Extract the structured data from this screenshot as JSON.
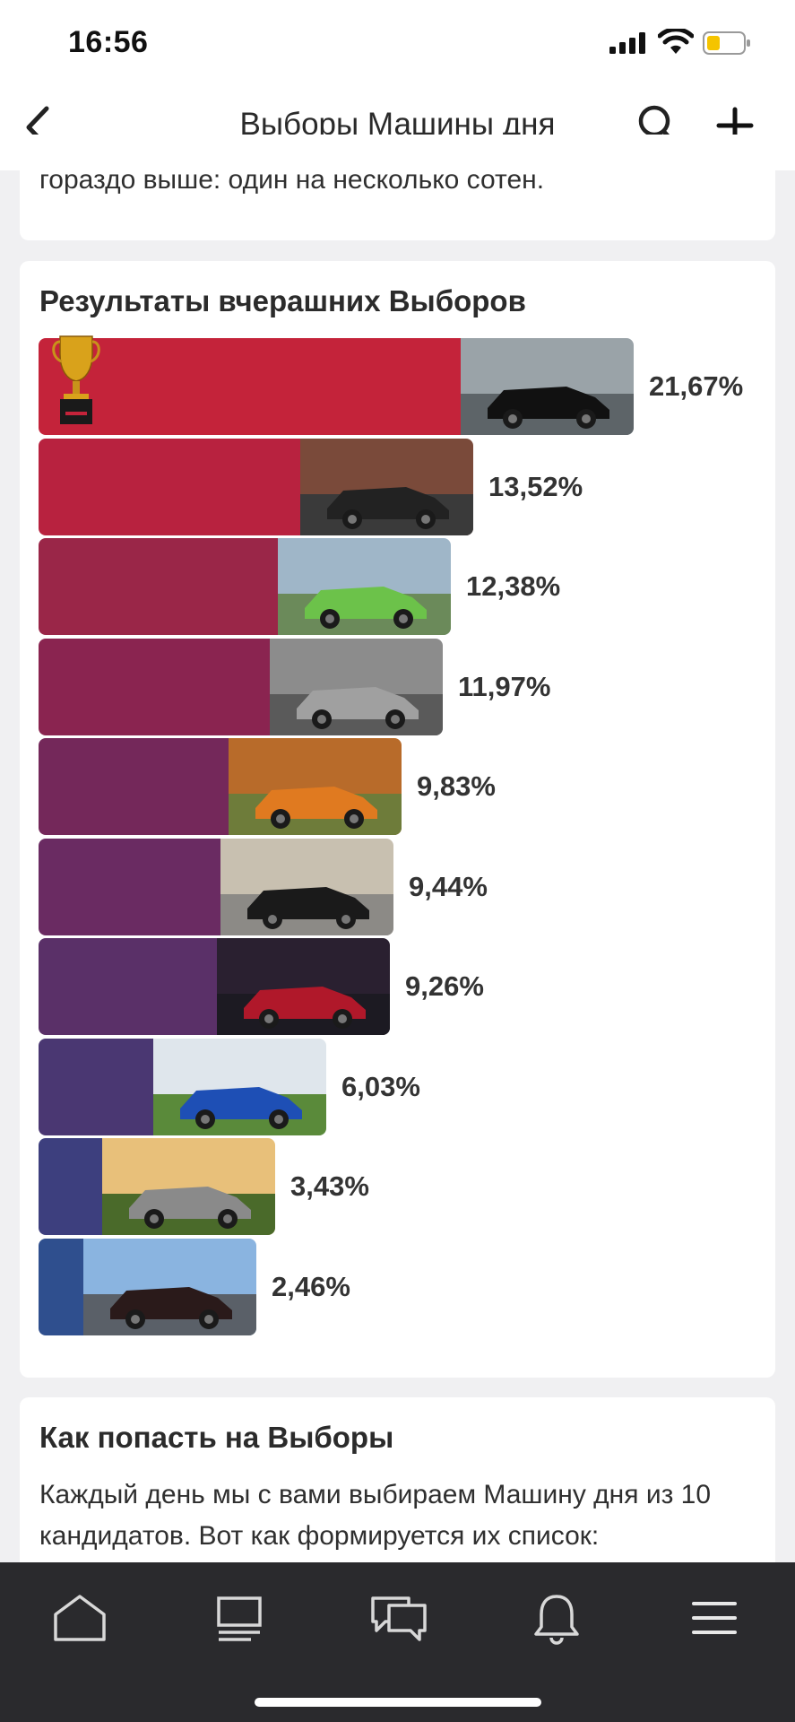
{
  "status_bar": {
    "time": "16:56"
  },
  "nav": {
    "title": "Выборы Машины дня"
  },
  "intro": {
    "text": "гораздо выше: один на несколько сотен."
  },
  "results": {
    "title": "Результаты вчерашних Выборов",
    "items": [
      {
        "percent_label": "21,67%",
        "value": 21.67,
        "color": "#c4233a",
        "photo": "black muscle car on road",
        "trophy": true
      },
      {
        "percent_label": "13,52%",
        "value": 13.52,
        "color": "#b8223f",
        "photo": "dark sedan with woman by brick wall"
      },
      {
        "percent_label": "12,38%",
        "value": 12.38,
        "color": "#9a2648",
        "photo": "green hatchback with people, mountains"
      },
      {
        "percent_label": "11,97%",
        "value": 11.97,
        "color": "#8a2450",
        "photo": "grey lifted off-road SUV"
      },
      {
        "percent_label": "9,83%",
        "value": 9.83,
        "color": "#74285a",
        "photo": "orange-black sedan in autumn"
      },
      {
        "percent_label": "9,44%",
        "value": 9.44,
        "color": "#6a2b62",
        "photo": "black hatchback on asphalt"
      },
      {
        "percent_label": "9,26%",
        "value": 9.26,
        "color": "#5a3068",
        "photo": "red pickup truck at night"
      },
      {
        "percent_label": "6,03%",
        "value": 6.03,
        "color": "#4a3772",
        "photo": "two blue sedans on grass"
      },
      {
        "percent_label": "3,43%",
        "value": 3.43,
        "color": "#3d3f7e",
        "photo": "silver hatchback in field at sunset"
      },
      {
        "percent_label": "2,46%",
        "value": 2.46,
        "color": "#2f4f8e",
        "photo": "dark sedan under blue sky"
      }
    ]
  },
  "how": {
    "title": "Как попасть на Выборы",
    "text": "Каждый день мы с вами выбираем Машину дня из 10 кандидатов. Вот как формируется их список:"
  },
  "tabbar": {
    "items": [
      {
        "icon": "home-icon"
      },
      {
        "icon": "feed-icon"
      },
      {
        "icon": "messages-icon"
      },
      {
        "icon": "notifications-icon"
      },
      {
        "icon": "menu-icon"
      }
    ]
  },
  "colors": {
    "tabbar_bg": "#2a2a2d",
    "page_bg": "#f0f0f2",
    "card_bg": "#ffffff"
  }
}
